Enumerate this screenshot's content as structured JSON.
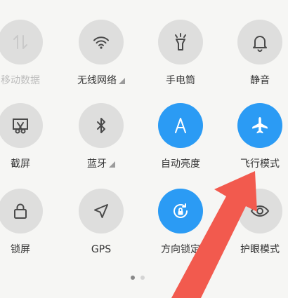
{
  "colors": {
    "active": "#2b9bf4",
    "inactive": "#dededd",
    "label": "#333333",
    "label_disabled": "#bdbdbd",
    "annotation_arrow": "#f25a4e"
  },
  "tiles": [
    {
      "name": "mobile-data",
      "label": "移动数据",
      "icon": "data-arrows-icon",
      "active": false,
      "disabled": true,
      "has_menu": false
    },
    {
      "name": "wifi",
      "label": "无线网络",
      "icon": "wifi-icon",
      "active": false,
      "disabled": false,
      "has_menu": true
    },
    {
      "name": "flashlight",
      "label": "手电筒",
      "icon": "flashlight-icon",
      "active": false,
      "disabled": false,
      "has_menu": false
    },
    {
      "name": "mute",
      "label": "静音",
      "icon": "bell-icon",
      "active": false,
      "disabled": false,
      "has_menu": false
    },
    {
      "name": "screenshot",
      "label": "截屏",
      "icon": "screenshot-scissors-icon",
      "active": false,
      "disabled": false,
      "has_menu": false
    },
    {
      "name": "bluetooth",
      "label": "蓝牙",
      "icon": "bluetooth-icon",
      "active": false,
      "disabled": false,
      "has_menu": true
    },
    {
      "name": "auto-brightness",
      "label": "自动亮度",
      "icon": "letter-a-icon",
      "active": true,
      "disabled": false,
      "has_menu": false
    },
    {
      "name": "airplane-mode",
      "label": "飞行模式",
      "icon": "airplane-icon",
      "active": true,
      "disabled": false,
      "has_menu": false
    },
    {
      "name": "lock-screen",
      "label": "锁屏",
      "icon": "lock-icon",
      "active": false,
      "disabled": false,
      "has_menu": false
    },
    {
      "name": "gps",
      "label": "GPS",
      "icon": "location-arrow-icon",
      "active": false,
      "disabled": false,
      "has_menu": false
    },
    {
      "name": "rotation-lock",
      "label": "方向锁定",
      "icon": "rotation-lock-icon",
      "active": true,
      "disabled": false,
      "has_menu": false
    },
    {
      "name": "eye-protection",
      "label": "护眼模式",
      "icon": "eye-icon",
      "active": false,
      "disabled": false,
      "has_menu": false
    }
  ],
  "pagination": {
    "count": 2,
    "current": 0
  }
}
